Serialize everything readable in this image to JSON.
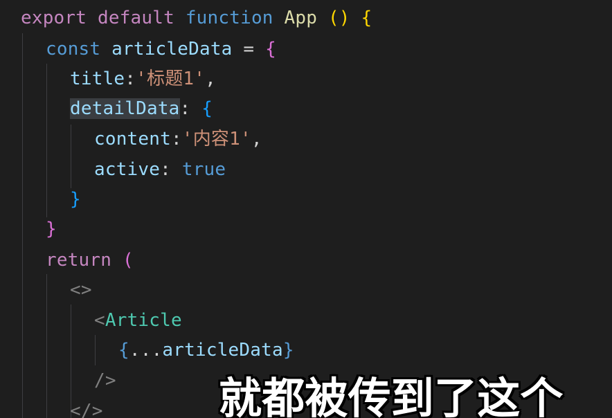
{
  "code": {
    "line1": {
      "export": "export",
      "default": "default",
      "function": "function",
      "name": "App",
      "paren_open": "(",
      "paren_close": ")",
      "brace": "{"
    },
    "line2": {
      "const": "const",
      "var": "articleData",
      "eq": "=",
      "brace": "{"
    },
    "line3": {
      "key": "title",
      "colon": ":",
      "value": "'标题1'",
      "comma": ","
    },
    "line4": {
      "key": "detailData",
      "colon": ":",
      "brace": "{"
    },
    "line5": {
      "key": "content",
      "colon": ":",
      "value": "'内容1'",
      "comma": ","
    },
    "line6": {
      "key": "active",
      "colon": ":",
      "value": "true"
    },
    "line7": {
      "brace": "}"
    },
    "line8": {
      "brace": "}"
    },
    "line9": {
      "return": "return",
      "paren": "("
    },
    "line10": {
      "fragment_open": "<>"
    },
    "line11": {
      "lt": "<",
      "tag": "Article"
    },
    "line12": {
      "brace_open": "{",
      "spread": "...",
      "var": "articleData",
      "brace_close": "}"
    },
    "line13": {
      "self_close": "/>"
    },
    "line14": {
      "fragment_close": "</>"
    }
  },
  "subtitle": {
    "text": "就都被传到了这个"
  },
  "colors": {
    "background": "#1e1e1e",
    "keyword": "#c586c0",
    "storage": "#569cd6",
    "function": "#dcdcaa",
    "variable": "#9cdcfe",
    "string": "#ce9178",
    "component": "#4ec9b0"
  }
}
